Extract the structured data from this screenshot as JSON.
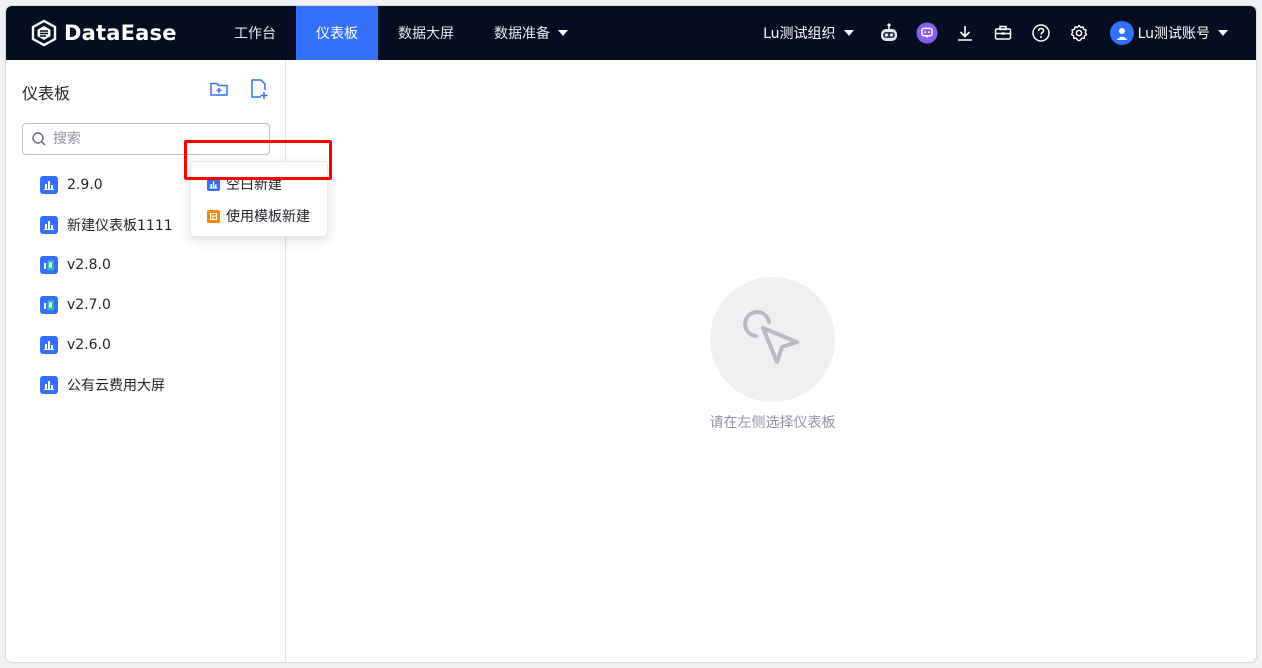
{
  "app": {
    "logo_text": "DataEase"
  },
  "nav": {
    "items": [
      {
        "label": "工作台"
      },
      {
        "label": "仪表板"
      },
      {
        "label": "数据大屏"
      },
      {
        "label": "数据准备"
      }
    ],
    "active_index": 1
  },
  "header": {
    "org_label": "Lu测试组织",
    "account_label": "Lu测试账号",
    "icons": [
      "robot-icon",
      "chat-assistant-icon",
      "download-icon",
      "toolbox-icon",
      "help-icon",
      "settings-icon"
    ]
  },
  "sidebar": {
    "title": "仪表板",
    "search_placeholder": "搜索",
    "items": [
      {
        "label": "2.9.0",
        "icon": "dashboard-icon"
      },
      {
        "label": "新建仪表板1111",
        "icon": "dashboard-icon"
      },
      {
        "label": "v2.8.0",
        "icon": "mobile-dashboard-icon"
      },
      {
        "label": "v2.7.0",
        "icon": "mobile-dashboard-icon"
      },
      {
        "label": "v2.6.0",
        "icon": "dashboard-icon"
      },
      {
        "label": "公有云费用大屏",
        "icon": "dashboard-icon"
      }
    ]
  },
  "dropdown": {
    "items": [
      {
        "label": "空白新建",
        "icon": "blank-dashboard-icon"
      },
      {
        "label": "使用模板新建",
        "icon": "template-icon"
      }
    ],
    "highlighted_index": 1
  },
  "main": {
    "empty_text": "请在左侧选择仪表板"
  },
  "colors": {
    "topbar": "#050e21",
    "accent": "#3370ff",
    "template_orange": "#ff8800",
    "highlight_red": "#ff0000"
  }
}
